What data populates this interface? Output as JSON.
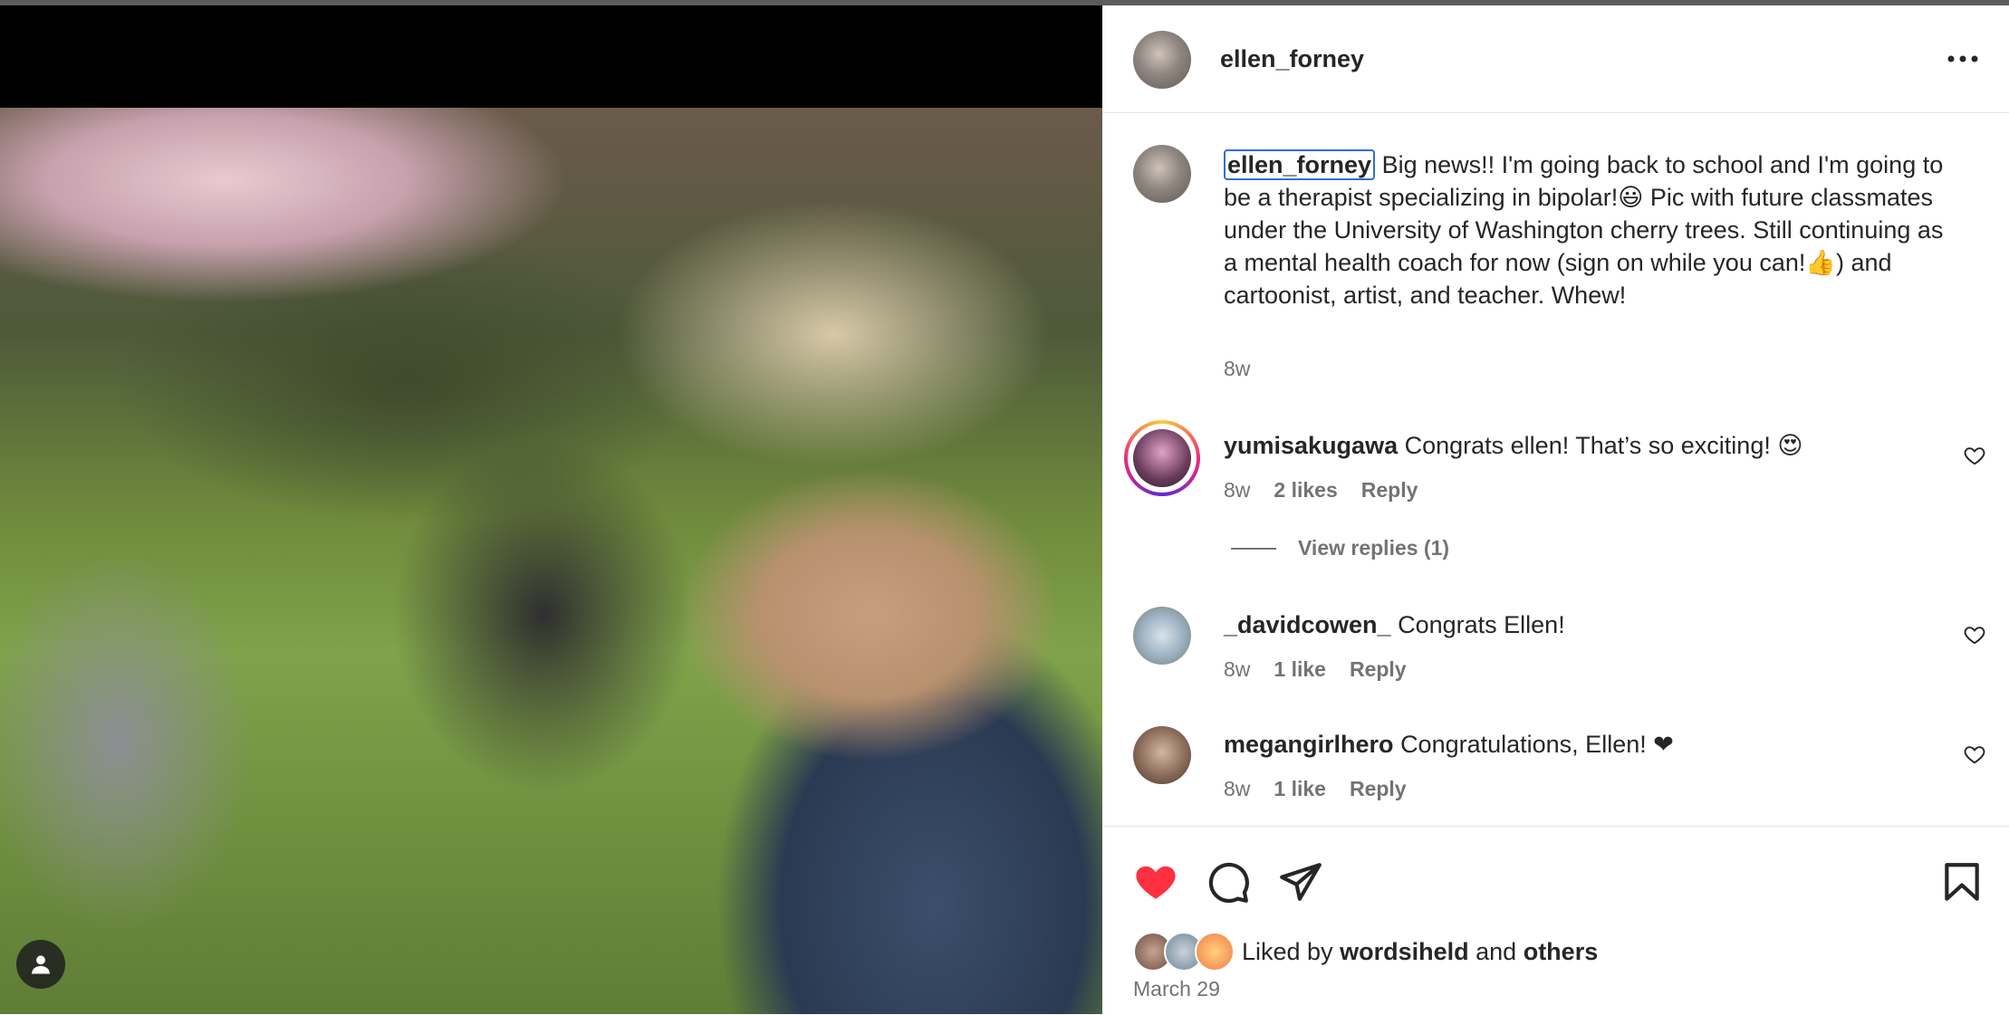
{
  "post": {
    "username": "ellen_forney",
    "caption_user": "ellen_forney",
    "caption_text": "Big news!! I'm going back to school and I'm going to be a therapist specializing in bipolar!😃 Pic with future classmates under the University of Washington cherry trees. Still continuing as a mental health coach for now (sign on while you can!👍) and cartoonist, artist, and teacher. Whew!",
    "caption_time": "8w"
  },
  "comments": [
    {
      "username": "yumisakugawa",
      "text": "Congrats ellen! That’s so exciting! 😍",
      "time": "8w",
      "likes": "2 likes",
      "reply": "Reply"
    },
    {
      "username": "_davidcowen_",
      "text": "Congrats Ellen!",
      "time": "8w",
      "likes": "1 like",
      "reply": "Reply"
    },
    {
      "username": "megangirlhero",
      "text": "Congratulations, Ellen! ❤",
      "time": "8w",
      "likes": "1 like",
      "reply": "Reply"
    }
  ],
  "view_replies": "View replies (1)",
  "likes_summary": {
    "prefix": "Liked by",
    "user": "wordsiheld",
    "connector": "and",
    "others": "others"
  },
  "date": "March 29",
  "colors": {
    "heart_filled": "#ff3040",
    "highlight_border": "#2f6fdc",
    "muted_text": "#737373"
  },
  "icons": {
    "more": "more-horizontal-icon",
    "like": "heart-filled-icon",
    "comment": "comment-icon",
    "share": "paper-plane-icon",
    "save": "bookmark-icon",
    "comment_like": "heart-outline-icon",
    "photo_tag": "user-tag-icon"
  }
}
